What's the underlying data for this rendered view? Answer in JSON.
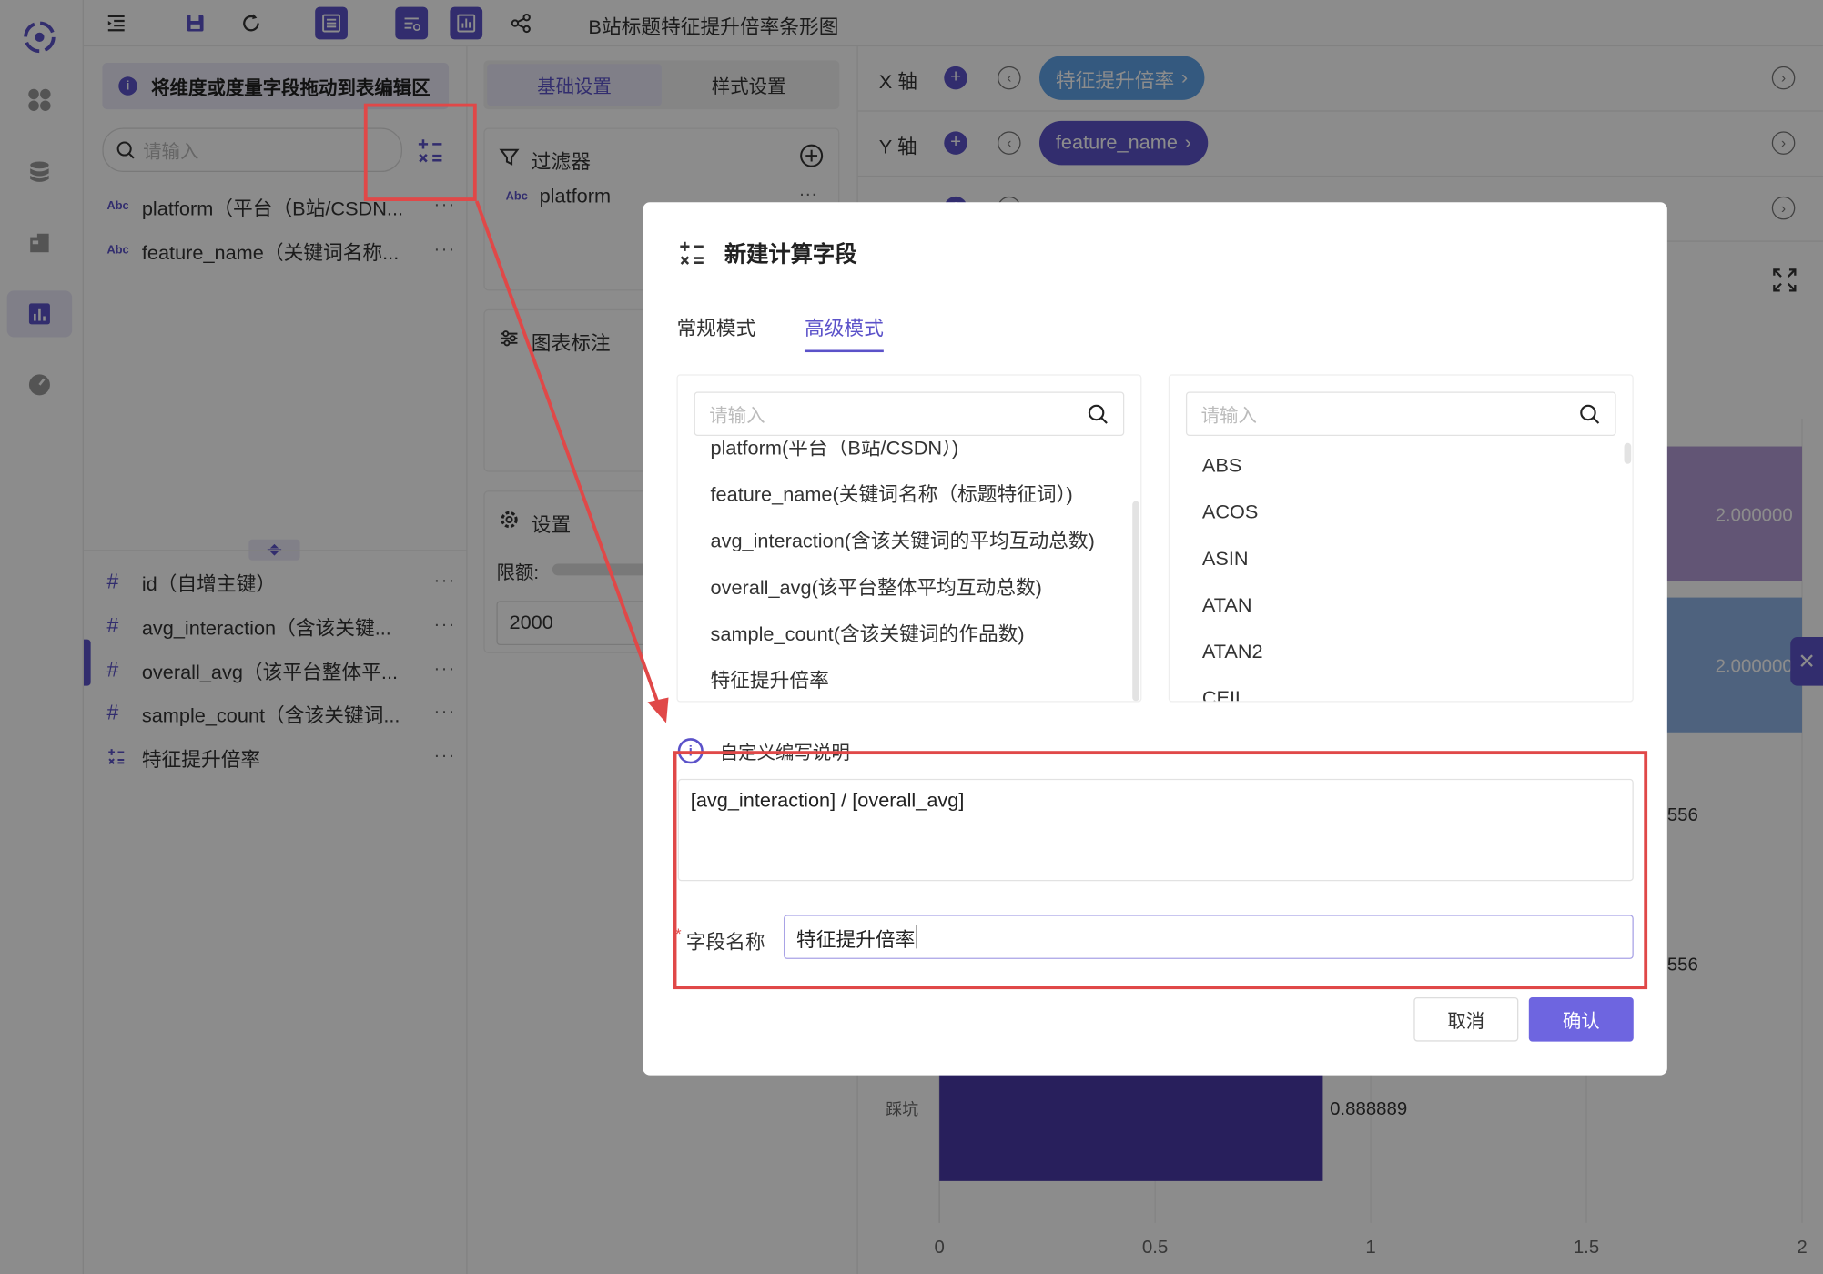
{
  "toolbar": {
    "title": "B站标题特征提升倍率条形图"
  },
  "field_panel": {
    "tip": "将维度或度量字段拖动到表编辑区",
    "search_placeholder": "请输入",
    "dimensions": [
      {
        "type": "Abc",
        "name": "platform（平台（B站/CSDN..."
      },
      {
        "type": "Abc",
        "name": "feature_name（关键词名称..."
      }
    ],
    "measures": [
      {
        "type": "#",
        "name": "id（自增主键）"
      },
      {
        "type": "#",
        "name": "avg_interaction（含该关键..."
      },
      {
        "type": "#",
        "name": "overall_avg（该平台整体平..."
      },
      {
        "type": "#",
        "name": "sample_count（含该关键词..."
      },
      {
        "type": "calc",
        "name": "特征提升倍率"
      }
    ],
    "more": "···"
  },
  "settings_panel": {
    "tab_basic": "基础设置",
    "tab_style": "样式设置",
    "filter_title": "过滤器",
    "filter_type": "Abc",
    "filter_field": "platform",
    "annotation_title": "图表标注",
    "settings_title": "设置",
    "limit_label": "限额:",
    "limit_value": "2000"
  },
  "axes": {
    "x_label": "X 轴",
    "x_field": "特征提升倍率",
    "y_label": "Y 轴",
    "y_field": "feature_name"
  },
  "chart_data": {
    "type": "bar",
    "orientation": "horizontal",
    "categories_visible": [
      "踩坑"
    ],
    "bar_color": "#4a3aa8",
    "visible_value_labels": [
      "2.000000",
      "2.000000",
      "556",
      "556",
      "0.888889"
    ],
    "xticks": [
      "0",
      "0.5",
      "1",
      "1.5",
      "2"
    ],
    "xlim": [
      0,
      2
    ],
    "bars": [
      {
        "category": "",
        "value": 2.0,
        "label": "2.000000",
        "color": "#b39bd6"
      },
      {
        "category": "",
        "value": 2.0,
        "label": "2.000000",
        "color": "#8fb3e6"
      },
      {
        "category": "踩坑",
        "value": 0.888889,
        "label": "0.888889",
        "color": "#4a3aa8"
      }
    ]
  },
  "dialog": {
    "title": "新建计算字段",
    "tab_normal": "常规模式",
    "tab_advanced": "高级模式",
    "field_search_placeholder": "请输入",
    "func_search_placeholder": "请输入",
    "field_list": [
      "platform(平台（B站/CSDN）)",
      "feature_name(关键词名称（标题特征词）)",
      "avg_interaction(含该关键词的平均互动总数)",
      "overall_avg(该平台整体平均互动总数)",
      "sample_count(含该关键词的作品数)",
      "特征提升倍率"
    ],
    "function_list": [
      "ABS",
      "ACOS",
      "ASIN",
      "ATAN",
      "ATAN2",
      "CEIL"
    ],
    "hint": "自定义编写说明",
    "formula": "[avg_interaction] / [overall_avg]",
    "name_label": "字段名称",
    "name_value": "特征提升倍率",
    "cancel": "取消",
    "confirm": "确认"
  }
}
